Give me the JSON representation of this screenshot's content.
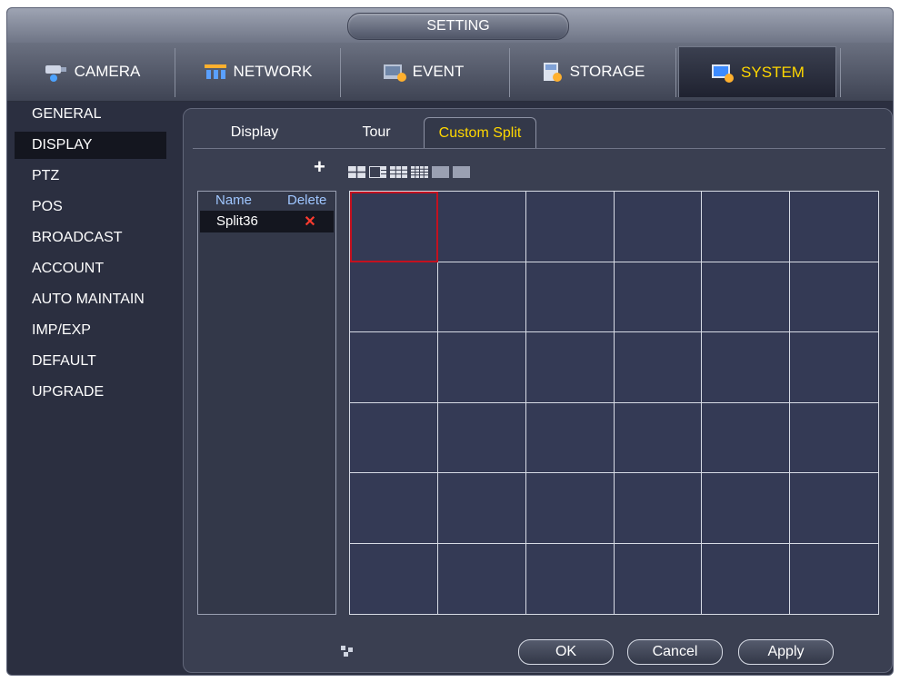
{
  "window": {
    "title": "SETTING"
  },
  "topnav": [
    {
      "label": "CAMERA",
      "icon": "camera-icon"
    },
    {
      "label": "NETWORK",
      "icon": "network-icon"
    },
    {
      "label": "EVENT",
      "icon": "event-icon"
    },
    {
      "label": "STORAGE",
      "icon": "storage-icon"
    },
    {
      "label": "SYSTEM",
      "icon": "system-icon",
      "active": true
    }
  ],
  "sidebar": [
    {
      "label": "GENERAL"
    },
    {
      "label": "DISPLAY",
      "active": true
    },
    {
      "label": "PTZ"
    },
    {
      "label": "POS"
    },
    {
      "label": "BROADCAST"
    },
    {
      "label": "ACCOUNT"
    },
    {
      "label": "AUTO MAINTAIN"
    },
    {
      "label": "IMP/EXP"
    },
    {
      "label": "DEFAULT"
    },
    {
      "label": "UPGRADE"
    }
  ],
  "subtabs": [
    {
      "label": "Display"
    },
    {
      "label": "Tour"
    },
    {
      "label": "Custom Split",
      "active": true
    }
  ],
  "toolbar": {
    "add_symbol": "+",
    "layout_icons": [
      "split-4-icon",
      "split-custom-icon",
      "split-9-icon",
      "split-16-icon",
      "split-25-icon",
      "split-36-icon"
    ]
  },
  "list": {
    "headers": {
      "name": "Name",
      "delete": "Delete"
    },
    "rows": [
      {
        "name": "Split36",
        "delete_symbol": "✕"
      }
    ]
  },
  "grid": {
    "rows": 6,
    "cols": 6,
    "selected_cell": 0
  },
  "buttons": {
    "ok": "OK",
    "cancel": "Cancel",
    "apply": "Apply"
  },
  "colors": {
    "active_text": "#ffd700",
    "selection": "#c3111f",
    "delete": "#ff3b2f"
  }
}
